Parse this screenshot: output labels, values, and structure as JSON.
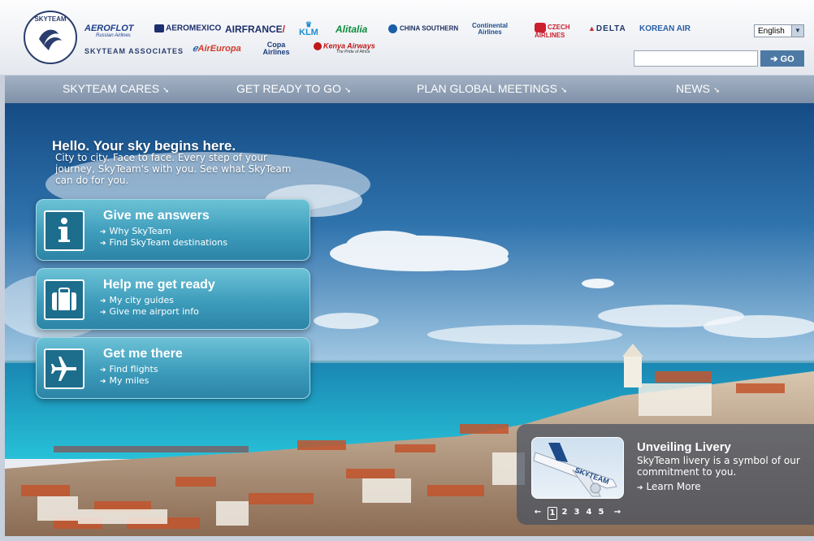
{
  "header": {
    "logo_text": "SKYTEAM",
    "members": [
      {
        "name": "AEROFLOT",
        "tagline": "Russian Airlines",
        "color": "#1e3f8a"
      },
      {
        "name": "AEROMEXICO",
        "color": "#1c2f6e"
      },
      {
        "name": "AIRFRANCE",
        "color": "#1e2f6a"
      },
      {
        "name": "KLM",
        "color": "#1a8fd0"
      },
      {
        "name": "Alitalia",
        "color": "#0b8a3c"
      },
      {
        "name": "CHINA SOUTHERN",
        "color": "#1a2c5e"
      },
      {
        "name": "Continental Airlines",
        "color": "#1b4c8e"
      },
      {
        "name": "CZECH AIRLINES",
        "color": "#cc1f2f"
      },
      {
        "name": "DELTA",
        "color": "#1d3768"
      },
      {
        "name": "KOREAN AIR",
        "color": "#2a5fa8"
      }
    ],
    "associates_label": "SKYTEAM ASSOCIATES",
    "associates": [
      {
        "name": "AirEuropa",
        "color": "#d23a2a"
      },
      {
        "name": "Copa Airlines",
        "color": "#1b3c78"
      },
      {
        "name": "Kenya Airways",
        "tagline": "The Pride of Africa",
        "color": "#c01717"
      }
    ]
  },
  "language": {
    "selected": "English"
  },
  "search": {
    "placeholder": "",
    "button_label": "GO"
  },
  "nav": {
    "items": [
      {
        "label": "SKYTEAM CARES"
      },
      {
        "label": "GET READY TO GO"
      },
      {
        "label": "PLAN GLOBAL MEETINGS"
      },
      {
        "label": "NEWS"
      }
    ]
  },
  "hero": {
    "title": "Hello. Your sky begins here.",
    "text": "City to city. Face to face. Every step of your journey, SkyTeam's with you. See what SkyTeam can do for you.",
    "panels": [
      {
        "title": "Give me answers",
        "links": [
          "Why SkyTeam",
          "Find SkyTeam destinations"
        ]
      },
      {
        "title": "Help me get ready",
        "links": [
          "My city guides",
          "Give me airport info"
        ]
      },
      {
        "title": "Get me there",
        "links": [
          "Find flights",
          "My miles"
        ]
      }
    ]
  },
  "promo": {
    "title": "Unveiling Livery",
    "text": "SkyTeam livery is a symbol of our commitment to you.",
    "link": "Learn More",
    "plane_text": "SKYTEAM",
    "pages": [
      "1",
      "2",
      "3",
      "4",
      "5"
    ],
    "current_page": "1"
  },
  "colors": {
    "nav_bg": "#8b9bb1",
    "panel": "#3d9cbb",
    "go_button": "#4d7aa5",
    "sea": "#1fa6c6",
    "sky": "#1d5a96"
  }
}
